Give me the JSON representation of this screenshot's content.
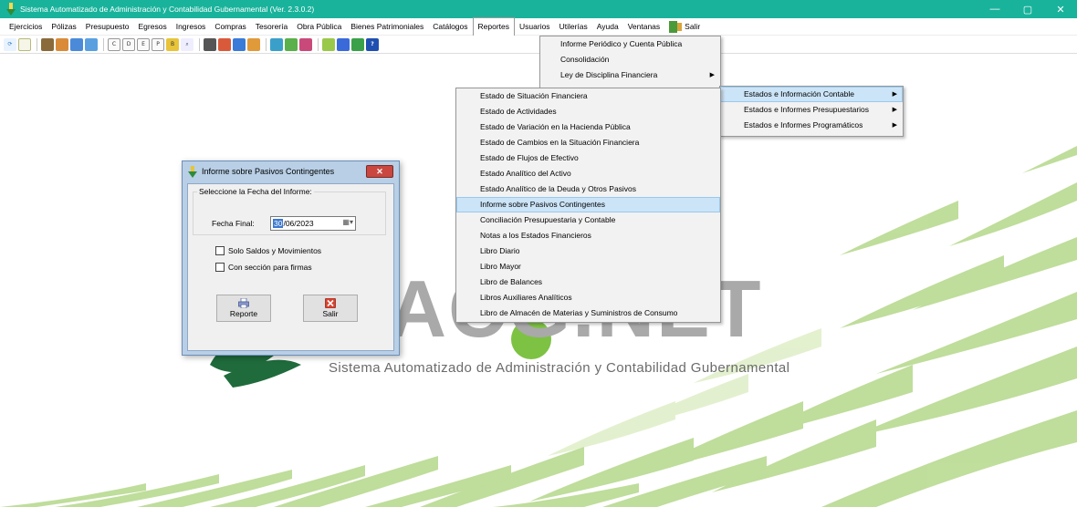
{
  "window": {
    "title": "Sistema Automatizado de Administración y Contabilidad Gubernamental  (Ver. 2.3.0.2)",
    "controls": [
      "—",
      "▢",
      "✕"
    ]
  },
  "menubar": {
    "items": [
      "Ejercicios",
      "Pólizas",
      "Presupuesto",
      "Egresos",
      "Ingresos",
      "Compras",
      "Tesorería",
      "Obra Pública",
      "Bienes Patrimoniales",
      "Catálogos",
      "Reportes",
      "Usuarios",
      "Utilerías",
      "Ayuda",
      "Ventanas"
    ],
    "salir_label": "Salir"
  },
  "reportes_menu": {
    "items": [
      "Informe Periódico y Cuenta Pública",
      "Consolidación",
      "Ley de Disciplina Financiera"
    ]
  },
  "ldf_submenu": {
    "items": [
      "Estados e Información Contable",
      "Estados e Informes Presupuestarios",
      "Estados e Informes Programáticos"
    ]
  },
  "contable_submenu": {
    "items": [
      "Estado de Situación Financiera",
      "Estado de Actividades",
      "Estado de Variación en la Hacienda Pública",
      "Estado de Cambios en la Situación Financiera",
      "Estado de Flujos de Efectivo",
      "Estado Analítico del Activo",
      "Estado Analítico de la Deuda y Otros Pasivos",
      "Informe sobre Pasivos Contingentes",
      "Conciliación Presupuestaria y Contable",
      "Notas a los Estados Financieros",
      "Libro Diario",
      "Libro Mayor",
      "Libro de Balances",
      "Libros Auxiliares Analíticos",
      "Libro de Almacén de Materias y Suministros de Consumo"
    ],
    "highlighted": "Informe sobre Pasivos Contingentes"
  },
  "dialog": {
    "title": "Informe sobre Pasivos Contingentes",
    "group_label": "Seleccione la Fecha del Informe:",
    "fecha_label": "Fecha Final:",
    "fecha_day": "30",
    "fecha_rest": "/06/2023",
    "check_saldos": "Solo Saldos y Movimientos",
    "check_firmas": "Con sección para firmas",
    "btn_reporte": "Reporte",
    "btn_salir": "Salir"
  },
  "background": {
    "brand": "AACG.NET",
    "tagline": "Sistema Automatizado de Administración y Contabilidad Gubernamental"
  },
  "colors": {
    "titlebar": "#19b39c",
    "brand_green": "#7dc243",
    "dark_green": "#1f6b3c",
    "menu_highlight": "#cce4f7"
  }
}
